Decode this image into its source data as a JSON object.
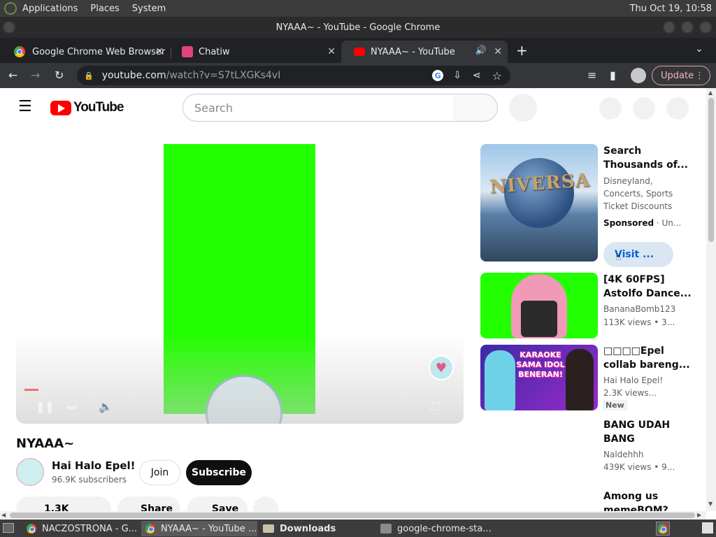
{
  "top_panel": {
    "menus": [
      "Applications",
      "Places",
      "System"
    ],
    "clock": "Thu Oct 19, 10:58"
  },
  "window": {
    "title": "NYAAA~ - YouTube - Google Chrome"
  },
  "tabs": [
    {
      "label": "Google Chrome Web Browser",
      "active": false
    },
    {
      "label": "Chatiw",
      "active": false
    },
    {
      "label": "NYAAA~ - YouTube",
      "active": true
    }
  ],
  "toolbar": {
    "url_host": "youtube.com",
    "url_path": "/watch?v=S7tLXGKs4vI",
    "update_label": "Update"
  },
  "youtube": {
    "logo_text": "YouTube",
    "search_placeholder": "Search",
    "video_title": "NYAAA~",
    "channel_name": "Hai Halo Epel!",
    "subscribers": "96.9K subscribers",
    "join_label": "Join",
    "subscribe_label": "Subscribe",
    "likes": "1.3K",
    "share_label": "Share",
    "save_label": "Save",
    "colors": {
      "green_screen": "#22ff00",
      "brand_red": "#ff0000"
    }
  },
  "recommendations": [
    {
      "title1": "Search",
      "title2": "Thousands of...",
      "sub1": "Disneyland,",
      "sub2": "Concerts, Sports",
      "sub3": "Ticket Discounts",
      "sponsored": "Sponsored",
      "sponsored_suffix": "· Un...",
      "visit": "Visit ...",
      "thumb_text": "NIVERSA"
    },
    {
      "title1": "[4K 60FPS]",
      "title2": "Astolfo Dance...",
      "sub1": "BananaBomb123",
      "sub2": "113K views  • 3..."
    },
    {
      "title1": "□□□□Epel",
      "title2": "collab bareng...",
      "sub1": "Hai Halo Epel!",
      "sub2": "2.3K views...",
      "badge": "New",
      "thumb_text": "KARAOKE SAMA IDOL BENERAN!"
    },
    {
      "title1": "BANG UDAH",
      "title2": "BANG",
      "sub1": "Naldehhh",
      "sub2": "439K views  • 9..."
    },
    {
      "title1": "Among us",
      "title2": "memeBOM?"
    }
  ],
  "taskbar": [
    {
      "label": "NACZOSTRONA - G...",
      "active": false
    },
    {
      "label": "NYAAA~ - YouTube ...",
      "active": true
    },
    {
      "label": "Downloads",
      "active": false
    },
    {
      "label": "google-chrome-sta...",
      "active": false
    }
  ]
}
